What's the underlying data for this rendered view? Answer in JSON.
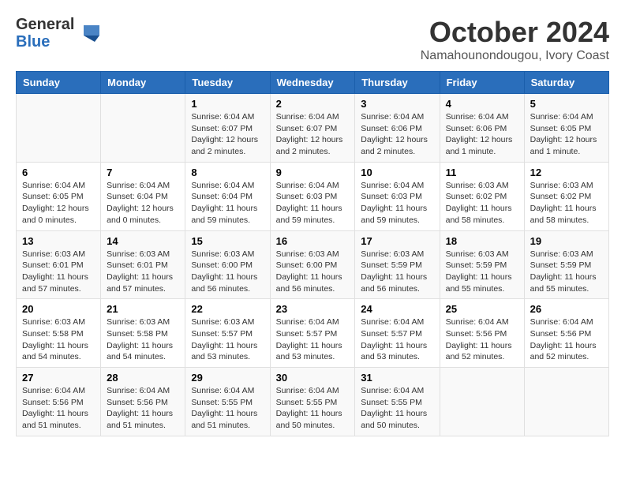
{
  "header": {
    "logo_general": "General",
    "logo_blue": "Blue",
    "month": "October 2024",
    "location": "Namahounondougou, Ivory Coast"
  },
  "weekdays": [
    "Sunday",
    "Monday",
    "Tuesday",
    "Wednesday",
    "Thursday",
    "Friday",
    "Saturday"
  ],
  "weeks": [
    [
      null,
      null,
      {
        "day": "1",
        "sunrise": "6:04 AM",
        "sunset": "6:07 PM",
        "daylight": "12 hours and 2 minutes."
      },
      {
        "day": "2",
        "sunrise": "6:04 AM",
        "sunset": "6:07 PM",
        "daylight": "12 hours and 2 minutes."
      },
      {
        "day": "3",
        "sunrise": "6:04 AM",
        "sunset": "6:06 PM",
        "daylight": "12 hours and 2 minutes."
      },
      {
        "day": "4",
        "sunrise": "6:04 AM",
        "sunset": "6:06 PM",
        "daylight": "12 hours and 1 minute."
      },
      {
        "day": "5",
        "sunrise": "6:04 AM",
        "sunset": "6:05 PM",
        "daylight": "12 hours and 1 minute."
      }
    ],
    [
      {
        "day": "6",
        "sunrise": "6:04 AM",
        "sunset": "6:05 PM",
        "daylight": "12 hours and 0 minutes."
      },
      {
        "day": "7",
        "sunrise": "6:04 AM",
        "sunset": "6:04 PM",
        "daylight": "12 hours and 0 minutes."
      },
      {
        "day": "8",
        "sunrise": "6:04 AM",
        "sunset": "6:04 PM",
        "daylight": "11 hours and 59 minutes."
      },
      {
        "day": "9",
        "sunrise": "6:04 AM",
        "sunset": "6:03 PM",
        "daylight": "11 hours and 59 minutes."
      },
      {
        "day": "10",
        "sunrise": "6:04 AM",
        "sunset": "6:03 PM",
        "daylight": "11 hours and 59 minutes."
      },
      {
        "day": "11",
        "sunrise": "6:03 AM",
        "sunset": "6:02 PM",
        "daylight": "11 hours and 58 minutes."
      },
      {
        "day": "12",
        "sunrise": "6:03 AM",
        "sunset": "6:02 PM",
        "daylight": "11 hours and 58 minutes."
      }
    ],
    [
      {
        "day": "13",
        "sunrise": "6:03 AM",
        "sunset": "6:01 PM",
        "daylight": "11 hours and 57 minutes."
      },
      {
        "day": "14",
        "sunrise": "6:03 AM",
        "sunset": "6:01 PM",
        "daylight": "11 hours and 57 minutes."
      },
      {
        "day": "15",
        "sunrise": "6:03 AM",
        "sunset": "6:00 PM",
        "daylight": "11 hours and 56 minutes."
      },
      {
        "day": "16",
        "sunrise": "6:03 AM",
        "sunset": "6:00 PM",
        "daylight": "11 hours and 56 minutes."
      },
      {
        "day": "17",
        "sunrise": "6:03 AM",
        "sunset": "5:59 PM",
        "daylight": "11 hours and 56 minutes."
      },
      {
        "day": "18",
        "sunrise": "6:03 AM",
        "sunset": "5:59 PM",
        "daylight": "11 hours and 55 minutes."
      },
      {
        "day": "19",
        "sunrise": "6:03 AM",
        "sunset": "5:59 PM",
        "daylight": "11 hours and 55 minutes."
      }
    ],
    [
      {
        "day": "20",
        "sunrise": "6:03 AM",
        "sunset": "5:58 PM",
        "daylight": "11 hours and 54 minutes."
      },
      {
        "day": "21",
        "sunrise": "6:03 AM",
        "sunset": "5:58 PM",
        "daylight": "11 hours and 54 minutes."
      },
      {
        "day": "22",
        "sunrise": "6:03 AM",
        "sunset": "5:57 PM",
        "daylight": "11 hours and 53 minutes."
      },
      {
        "day": "23",
        "sunrise": "6:04 AM",
        "sunset": "5:57 PM",
        "daylight": "11 hours and 53 minutes."
      },
      {
        "day": "24",
        "sunrise": "6:04 AM",
        "sunset": "5:57 PM",
        "daylight": "11 hours and 53 minutes."
      },
      {
        "day": "25",
        "sunrise": "6:04 AM",
        "sunset": "5:56 PM",
        "daylight": "11 hours and 52 minutes."
      },
      {
        "day": "26",
        "sunrise": "6:04 AM",
        "sunset": "5:56 PM",
        "daylight": "11 hours and 52 minutes."
      }
    ],
    [
      {
        "day": "27",
        "sunrise": "6:04 AM",
        "sunset": "5:56 PM",
        "daylight": "11 hours and 51 minutes."
      },
      {
        "day": "28",
        "sunrise": "6:04 AM",
        "sunset": "5:56 PM",
        "daylight": "11 hours and 51 minutes."
      },
      {
        "day": "29",
        "sunrise": "6:04 AM",
        "sunset": "5:55 PM",
        "daylight": "11 hours and 51 minutes."
      },
      {
        "day": "30",
        "sunrise": "6:04 AM",
        "sunset": "5:55 PM",
        "daylight": "11 hours and 50 minutes."
      },
      {
        "day": "31",
        "sunrise": "6:04 AM",
        "sunset": "5:55 PM",
        "daylight": "11 hours and 50 minutes."
      },
      null,
      null
    ]
  ],
  "labels": {
    "sunrise": "Sunrise:",
    "sunset": "Sunset:",
    "daylight": "Daylight:"
  }
}
